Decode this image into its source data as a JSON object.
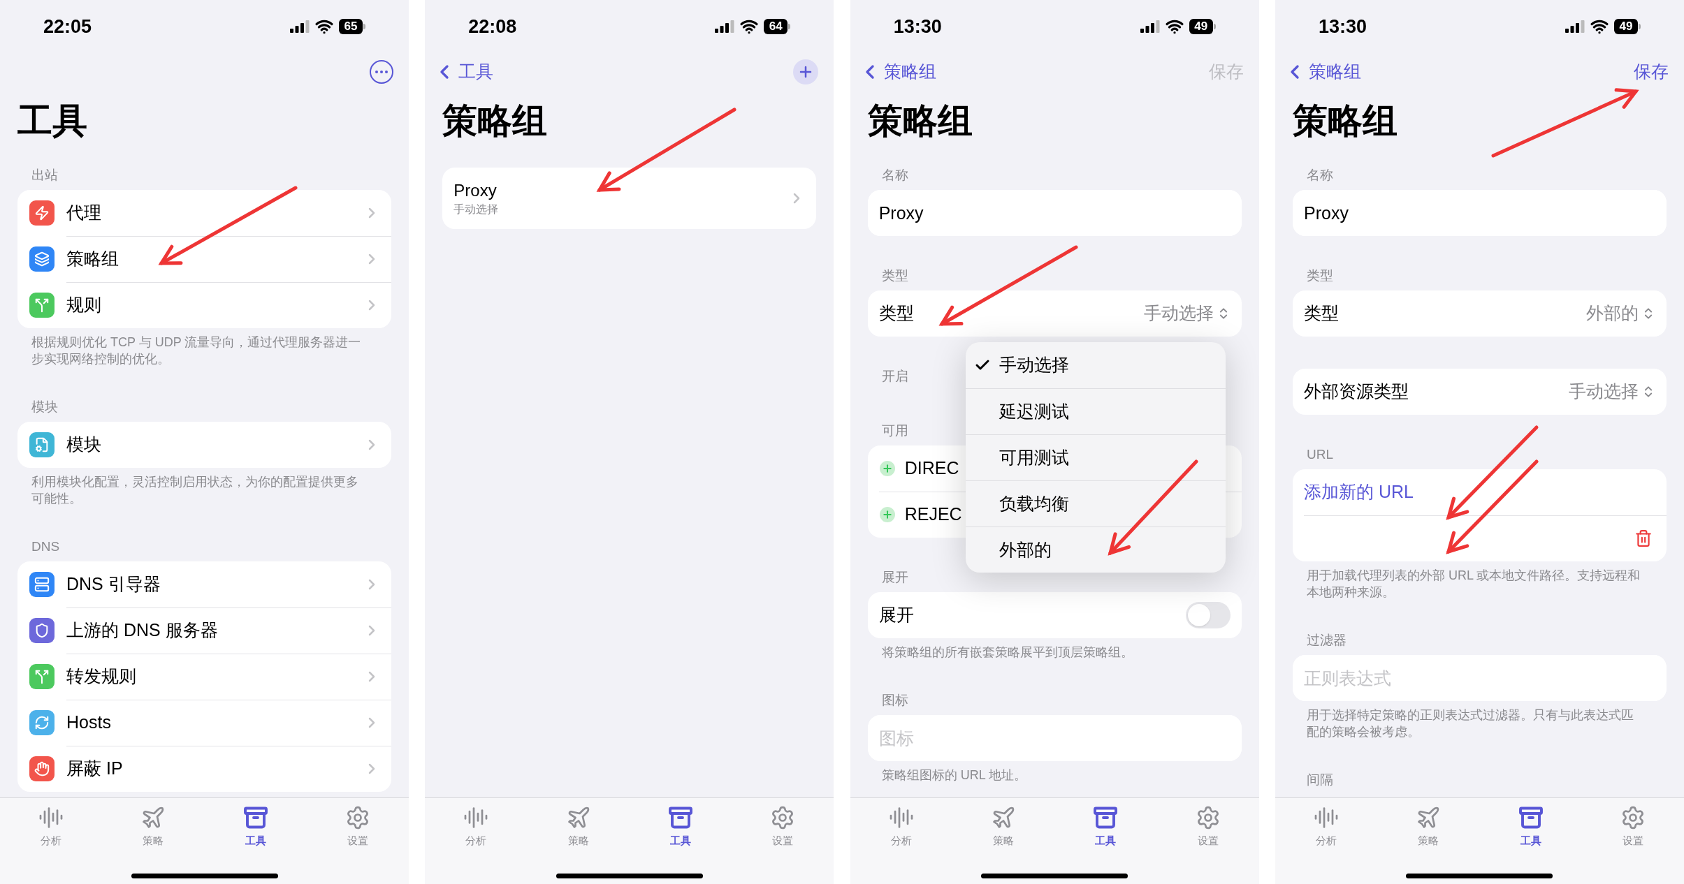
{
  "screens": [
    {
      "status": {
        "time": "22:05",
        "battery": "65"
      },
      "nav": {
        "trailing": {
          "kind": "more"
        }
      },
      "title": "工具",
      "sections": [
        {
          "header": "出站",
          "rows": [
            {
              "kind": "nav",
              "color": "#f2554b",
              "label": "代理"
            },
            {
              "kind": "nav",
              "color": "#2f86f6",
              "label": "策略组"
            },
            {
              "kind": "nav",
              "color": "#4cc95e",
              "label": "规则"
            }
          ],
          "footer": "根据规则优化 TCP 与 UDP 流量导向，通过代理服务器进一步实现网络控制的优化。"
        },
        {
          "header": "模块",
          "rows": [
            {
              "kind": "nav",
              "color": "#3fb6d6",
              "label": "模块"
            }
          ],
          "footer": "利用模块化配置，灵活控制启用状态，为你的配置提供更多可能性。"
        },
        {
          "header": "DNS",
          "rows": [
            {
              "kind": "nav",
              "color": "#2f86f6",
              "label": "DNS 引导器"
            },
            {
              "kind": "nav",
              "color": "#6d68db",
              "label": "上游的 DNS 服务器"
            },
            {
              "kind": "nav",
              "color": "#4cc95e",
              "label": "转发规则"
            },
            {
              "kind": "nav",
              "color": "#4cb1ea",
              "label": "Hosts"
            },
            {
              "kind": "nav",
              "color": "#f2554b",
              "label": "屏蔽 IP"
            }
          ]
        }
      ],
      "tabs": [
        {
          "label": "分析",
          "selected": false
        },
        {
          "label": "策略",
          "selected": false
        },
        {
          "label": "工具",
          "selected": true
        },
        {
          "label": "设置",
          "selected": false
        }
      ]
    },
    {
      "status": {
        "time": "22:08",
        "battery": "64"
      },
      "nav": {
        "back": {
          "label": "工具"
        },
        "trailing": {
          "kind": "add"
        }
      },
      "title": "策略组",
      "sections": [
        {
          "rows": [
            {
              "kind": "detail",
              "label": "Proxy",
              "subtitle": "手动选择"
            }
          ]
        }
      ],
      "tabs": [
        {
          "label": "分析",
          "selected": false
        },
        {
          "label": "策略",
          "selected": false
        },
        {
          "label": "工具",
          "selected": true
        },
        {
          "label": "设置",
          "selected": false
        }
      ]
    },
    {
      "status": {
        "time": "13:30",
        "battery": "49"
      },
      "nav": {
        "back": {
          "label": "策略组"
        },
        "trailing": {
          "kind": "text",
          "label": "保存",
          "disabled": true
        }
      },
      "title": "策略组",
      "sections": [
        {
          "header": "名称",
          "rows": [
            {
              "kind": "field",
              "value": "Proxy"
            }
          ]
        },
        {
          "header": "类型",
          "rows": [
            {
              "kind": "picker",
              "label": "类型",
              "value": "手动选择"
            }
          ]
        },
        {
          "header": "开启"
        },
        {
          "header": "可用",
          "rows": [
            {
              "kind": "add",
              "label": "DIREC"
            },
            {
              "kind": "add",
              "label": "REJEC"
            }
          ]
        },
        {
          "header": "展开",
          "rows": [
            {
              "kind": "toggle",
              "label": "展开",
              "on": false
            }
          ],
          "footer": "将策略组的所有嵌套策略展平到顶层策略组。"
        },
        {
          "header": "图标",
          "rows": [
            {
              "kind": "field",
              "placeholder": "图标"
            }
          ],
          "footer": "策略组图标的 URL 地址。"
        }
      ],
      "menu": {
        "items": [
          {
            "label": "手动选择",
            "selected": true
          },
          {
            "label": "延迟测试",
            "selected": false
          },
          {
            "label": "可用测试",
            "selected": false
          },
          {
            "label": "负载均衡",
            "selected": false
          },
          {
            "label": "外部的",
            "selected": false
          }
        ]
      },
      "tabs": [
        {
          "label": "分析",
          "selected": false
        },
        {
          "label": "策略",
          "selected": false
        },
        {
          "label": "工具",
          "selected": true
        },
        {
          "label": "设置",
          "selected": false
        }
      ]
    },
    {
      "status": {
        "time": "13:30",
        "battery": "49"
      },
      "nav": {
        "back": {
          "label": "策略组"
        },
        "trailing": {
          "kind": "text",
          "label": "保存",
          "disabled": false
        }
      },
      "title": "策略组",
      "sections": [
        {
          "header": "名称",
          "rows": [
            {
              "kind": "field",
              "value": "Proxy"
            }
          ]
        },
        {
          "header": "类型",
          "rows": [
            {
              "kind": "picker",
              "label": "类型",
              "value": "外部的"
            }
          ]
        },
        {
          "rows": [
            {
              "kind": "picker",
              "label": "外部资源类型",
              "value": "手动选择"
            }
          ]
        },
        {
          "header": "URL",
          "rows": [
            {
              "kind": "link",
              "label": "添加新的 URL"
            },
            {
              "kind": "trash"
            }
          ],
          "footer": "用于加载代理列表的外部 URL 或本地文件路径。支持远程和本地两种来源。"
        },
        {
          "header": "过滤器",
          "rows": [
            {
              "kind": "field",
              "placeholder": "正则表达式"
            }
          ],
          "footer": "用于选择特定策略的正则表达式过滤器。只有与此表达式匹配的策略会被考虑。"
        },
        {
          "header": "间隔"
        }
      ],
      "tabs": [
        {
          "label": "分析",
          "selected": false
        },
        {
          "label": "策略",
          "selected": false
        },
        {
          "label": "工具",
          "selected": true
        },
        {
          "label": "设置",
          "selected": false
        }
      ]
    }
  ]
}
